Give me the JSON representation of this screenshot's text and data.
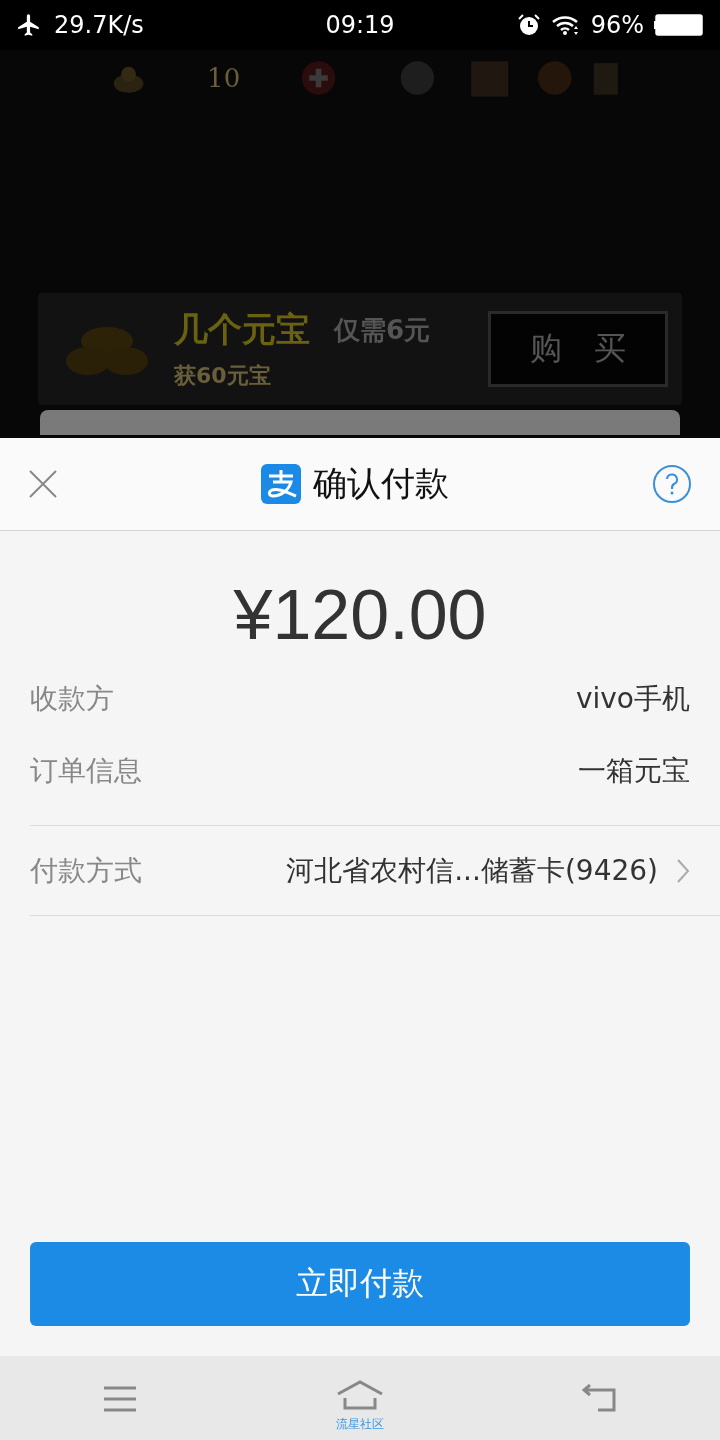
{
  "status_bar": {
    "speed": "29.7K/s",
    "time": "09:19",
    "battery": "96%"
  },
  "game": {
    "counter": "10",
    "offer_title": "几个元宝",
    "offer_price": "仅需6元",
    "offer_reward": "获60元宝",
    "buy_button": "购　买"
  },
  "sheet": {
    "title": "确认付款",
    "amount": "¥120.00",
    "rows": [
      {
        "label": "收款方",
        "value": "vivo手机",
        "kind": "plain"
      },
      {
        "label": "订单信息",
        "value": "一箱元宝",
        "kind": "plain"
      },
      {
        "label": "付款方式",
        "value": "河北省农村信...储蓄卡(9426)",
        "kind": "link"
      }
    ],
    "pay_button": "立即付款"
  },
  "nav_bar": {
    "home_label": "流星社区"
  }
}
